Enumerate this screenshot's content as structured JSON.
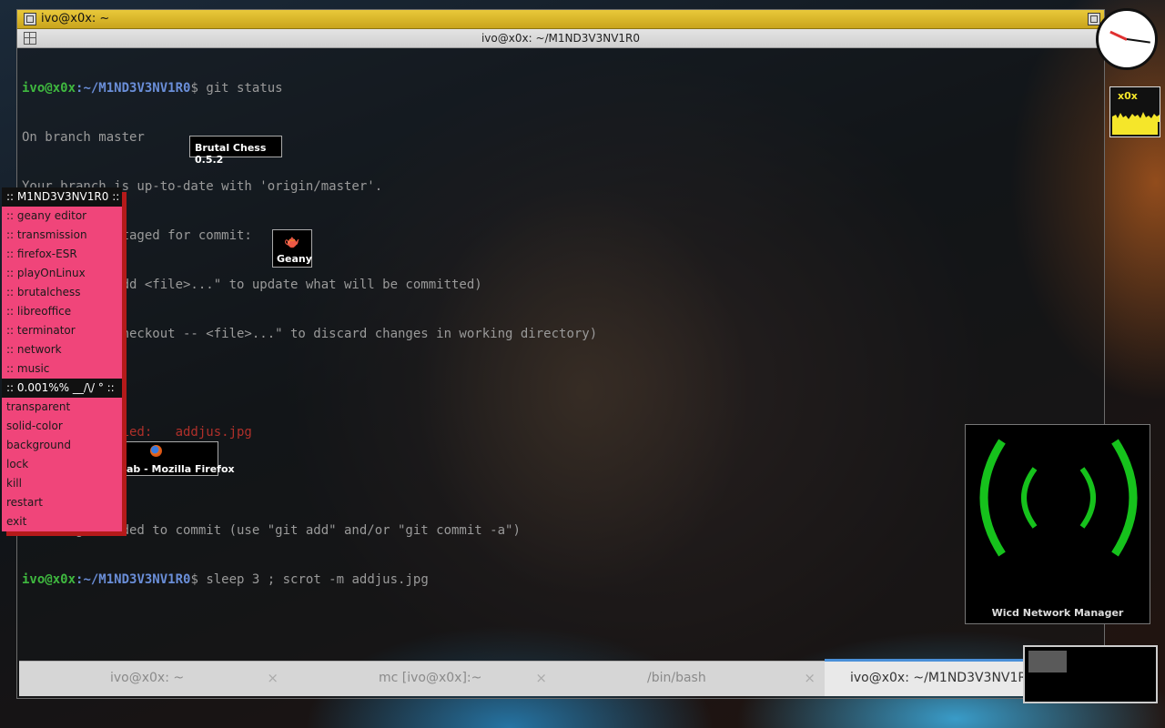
{
  "window": {
    "title": "ivo@x0x: ~",
    "terminal_title": "ivo@x0x: ~/M1ND3V3NV1R0"
  },
  "terminal": {
    "prompt_user": "ivo@x0x",
    "prompt_path": ":~/M1ND3V3NV1R0",
    "prompt_symbol": "$",
    "cmd1": " git status",
    "line2": "On branch master",
    "line3": "Your branch is up-to-date with 'origin/master'.",
    "line4": "Changes not staged for commit:",
    "line5": "  (use \"git add <file>...\" to update what will be committed)",
    "line6": "  (use \"git checkout -- <file>...\" to discard changes in working directory)",
    "modified_label": "        modified:   ",
    "modified_file": "addjus.jpg",
    "line9": "no changes added to commit (use \"git add\" and/or \"git commit -a\")",
    "cmd2": " sleep 3 ; scrot -m addjus.jpg"
  },
  "tabs": [
    {
      "label": "ivo@x0x: ~",
      "close": "×"
    },
    {
      "label": "mc [ivo@x0x]:~",
      "close": "×"
    },
    {
      "label": "/bin/bash",
      "close": "×"
    },
    {
      "label": "ivo@x0x: ~/M1ND3V3NV1R0",
      "close": ""
    }
  ],
  "icons": {
    "chess": "Brutal Chess 0.5.2",
    "geany": "Geany",
    "firefox": "ab - Mozilla Firefox"
  },
  "menu": {
    "header1": ":: M1ND3V3NV1R0 ::",
    "items1": [
      ":: geany editor",
      ":: transmission",
      ":: firefox-ESR",
      ":: playOnLinux",
      ":: brutalchess",
      ":: libreoffice",
      ":: terminator",
      ":: network",
      ":: music"
    ],
    "header2": ":: 0.001%% __/\\/ ° ::",
    "items2": [
      "transparent",
      "solid-color",
      "background",
      "lock",
      "kill",
      "restart",
      "exit"
    ]
  },
  "cpu": {
    "label": "x0x",
    "color": "#f5e62a"
  },
  "wicd": {
    "label": "Wicd Network Manager",
    "color": "#16c21c"
  },
  "colors": {
    "menu_bg": "#f0457a",
    "menu_shadow": "#b51a1a",
    "titlebar": "#e0bd2e",
    "tab_accent": "#4a90d9"
  }
}
